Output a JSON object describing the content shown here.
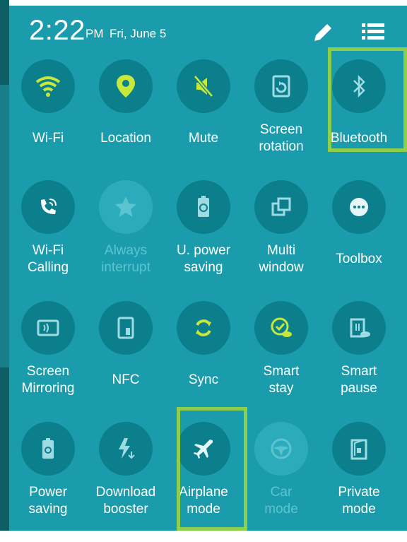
{
  "status": {
    "time": "2:22",
    "ampm": "PM",
    "date": "Fri, June 5"
  },
  "icons": {
    "edit": "pencil-icon",
    "list": "list-icon"
  },
  "tiles": [
    {
      "label": "Wi-Fi",
      "icon": "wifi-icon",
      "state": "on"
    },
    {
      "label": "Location",
      "icon": "location-pin-icon",
      "state": "on"
    },
    {
      "label": "Mute",
      "icon": "mute-icon",
      "state": "on"
    },
    {
      "label": "Screen\nrotation",
      "icon": "screen-rotation-icon",
      "state": "off"
    },
    {
      "label": "Bluetooth",
      "icon": "bluetooth-icon",
      "state": "off"
    },
    {
      "label": "Wi-Fi\nCalling",
      "icon": "wifi-calling-icon",
      "state": "off"
    },
    {
      "label": "Always\ninterrupt",
      "icon": "star-icon",
      "state": "disabled"
    },
    {
      "label": "U. power\nsaving",
      "icon": "ultra-power-saving-icon",
      "state": "off"
    },
    {
      "label": "Multi\nwindow",
      "icon": "multi-window-icon",
      "state": "off"
    },
    {
      "label": "Toolbox",
      "icon": "toolbox-icon",
      "state": "off"
    },
    {
      "label": "Screen\nMirroring",
      "icon": "screen-mirroring-icon",
      "state": "off"
    },
    {
      "label": "NFC",
      "icon": "nfc-icon",
      "state": "off"
    },
    {
      "label": "Sync",
      "icon": "sync-icon",
      "state": "on"
    },
    {
      "label": "Smart\nstay",
      "icon": "smart-stay-icon",
      "state": "on"
    },
    {
      "label": "Smart\npause",
      "icon": "smart-pause-icon",
      "state": "off"
    },
    {
      "label": "Power\nsaving",
      "icon": "power-saving-icon",
      "state": "off"
    },
    {
      "label": "Download\nbooster",
      "icon": "download-booster-icon",
      "state": "off"
    },
    {
      "label": "Airplane\nmode",
      "icon": "airplane-icon",
      "state": "off"
    },
    {
      "label": "Car\nmode",
      "icon": "car-mode-icon",
      "state": "disabled"
    },
    {
      "label": "Private\nmode",
      "icon": "private-mode-icon",
      "state": "off"
    }
  ],
  "colors": {
    "panel": "#1b9cad",
    "active_icon": "#c6e83a",
    "highlight": "#8ed04a"
  }
}
